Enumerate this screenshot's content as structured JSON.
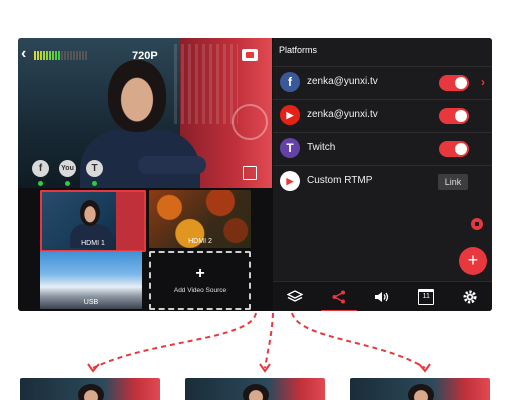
{
  "preview": {
    "resolution": "720P"
  },
  "sources": [
    {
      "label": "HDMI 1",
      "selected": true
    },
    {
      "label": "HDMI 2",
      "selected": false
    },
    {
      "label": "USB",
      "selected": false
    }
  ],
  "add_source_label": "Add Video Source",
  "add_source_symbol": "+",
  "mini_platforms": [
    "f",
    "You",
    "T"
  ],
  "panel": {
    "title": "Platforms",
    "platforms": [
      {
        "name": "zenka@yunxi.tv",
        "icon": "facebook-icon",
        "glyph": "f",
        "color": "#3b5998",
        "enabled": true
      },
      {
        "name": "zenka@yunxi.tv",
        "icon": "youtube-icon",
        "glyph": "▶",
        "color": "#e62117",
        "enabled": true
      },
      {
        "name": "Twitch",
        "icon": "twitch-icon",
        "glyph": "T",
        "color": "#6441a5",
        "enabled": true
      },
      {
        "name": "Custom RTMP",
        "icon": "rtmp-icon",
        "glyph": "▶",
        "color": "#ffffff",
        "action": "Link"
      }
    ],
    "fab_symbol": "+"
  },
  "toolbar": {
    "items": [
      "layers-icon",
      "share-icon",
      "volume-icon",
      "calendar-icon",
      "settings-icon"
    ],
    "active": "share-icon",
    "calendar_text": "11"
  },
  "colors": {
    "accent": "#e8383e",
    "live": "#2ecc40"
  }
}
